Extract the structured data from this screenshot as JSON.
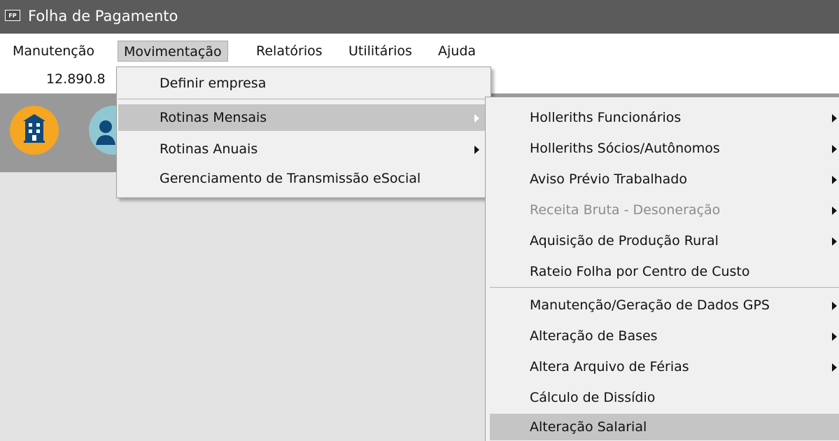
{
  "window": {
    "icon_text": "FP",
    "title": "Folha de Pagamento"
  },
  "menubar": {
    "items": [
      {
        "label": "Manutenção"
      },
      {
        "label": "Movimentação"
      },
      {
        "label": "Relatórios"
      },
      {
        "label": "Utilitários"
      },
      {
        "label": "Ajuda"
      }
    ]
  },
  "info": {
    "value": "12.890.8"
  },
  "toolbar": {
    "buttons": [
      {
        "icon": "building-icon"
      },
      {
        "icon": "person-icon"
      }
    ]
  },
  "dropdown": {
    "items": [
      {
        "label": "Definir empresa"
      },
      {
        "label": "Rotinas Mensais"
      },
      {
        "label": "Rotinas Anuais"
      },
      {
        "label": "Gerenciamento de Transmissão eSocial"
      }
    ]
  },
  "submenu": {
    "items": [
      {
        "label": "Holleriths Funcionários"
      },
      {
        "label": "Holleriths Sócios/Autônomos"
      },
      {
        "label": "Aviso Prévio Trabalhado"
      },
      {
        "label": "Receita Bruta - Desoneração"
      },
      {
        "label": "Aquisição de Produção Rural"
      },
      {
        "label": "Rateio Folha por Centro de Custo"
      },
      {
        "label": "Manutenção/Geração de Dados GPS"
      },
      {
        "label": "Alteração de Bases"
      },
      {
        "label": "Altera Arquivo de Férias"
      },
      {
        "label": "Cálculo de Dissídio"
      },
      {
        "label": "Alteração Salarial"
      }
    ]
  },
  "colors": {
    "titlebar": "#5b5b5b",
    "toolbar": "#999999",
    "menu_bg": "#f0f0f0",
    "highlight": "#c5c5c5",
    "disabled_text": "#8c8c8c",
    "company_button": "#f5a623",
    "people_button": "#8fc8d3"
  }
}
